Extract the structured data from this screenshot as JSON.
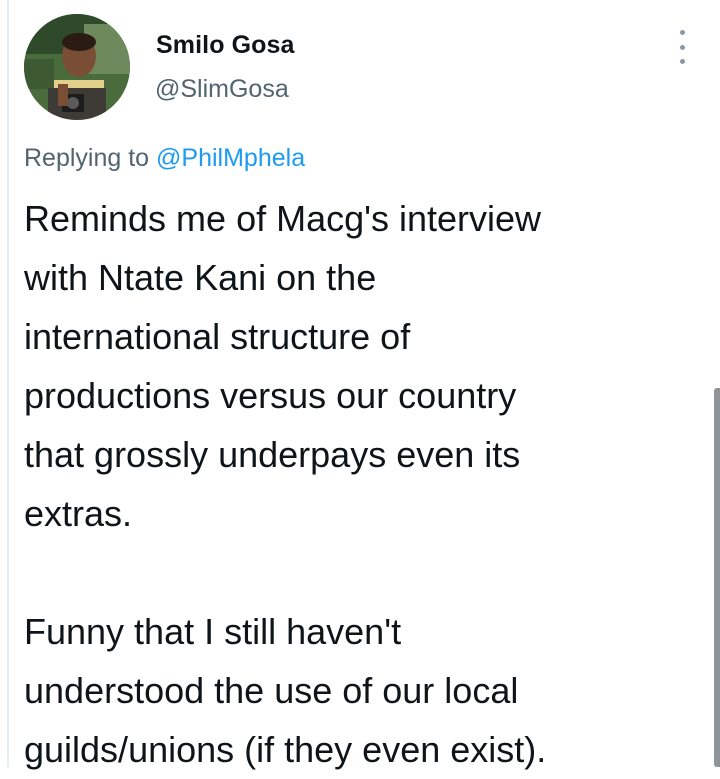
{
  "tweet": {
    "author": {
      "display_name": "Smilo Gosa",
      "handle": "@SlimGosa",
      "avatar_icon": "profile-photo"
    },
    "reply": {
      "prefix": "Replying to ",
      "target": "@PhilMphela"
    },
    "body": {
      "lines_p1": [
        "Reminds me of Macg's interview",
        "with Ntate Kani on the",
        "international structure of",
        "productions versus our country",
        "that grossly underpays even its",
        "extras."
      ],
      "lines_p2": [
        "Funny that I still haven't",
        "understood the use of our local",
        "guilds/unions (if they even exist)."
      ]
    },
    "more_icon": "more-vertical-icon"
  },
  "colors": {
    "text": "#0f1419",
    "secondary": "#536471",
    "link": "#1d9bf0",
    "icon": "#8b98a5"
  }
}
